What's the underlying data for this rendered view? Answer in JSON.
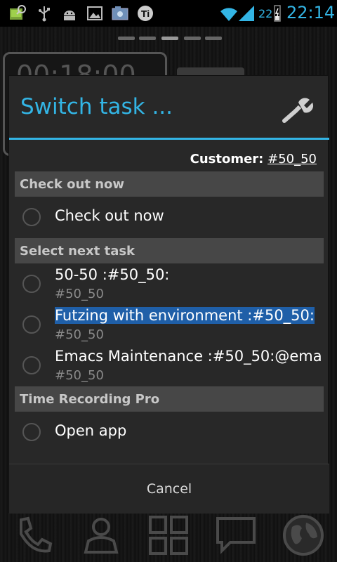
{
  "statusbar": {
    "battery_pct": "22",
    "time": "22:14",
    "icons": [
      "gallery-icon",
      "usb-icon",
      "android-debug-icon",
      "image-icon",
      "screenshot-icon",
      "titanium-icon",
      "wifi-icon",
      "signal-icon",
      "battery-icon"
    ]
  },
  "home": {
    "widget_time": "00:18:00"
  },
  "dialog": {
    "title": "Switch task ...",
    "customer_label": "Customer:",
    "customer_value": "#50_50",
    "sections": [
      {
        "label": "Check out now",
        "rows": [
          {
            "title": "Check out now"
          }
        ]
      },
      {
        "label": "Select next task",
        "rows": [
          {
            "title": "50-50 :#50_50:",
            "subtitle": "#50_50"
          },
          {
            "title": "Futzing with environment :#50_50:",
            "subtitle": "#50_50",
            "selected": true
          },
          {
            "title": "Emacs Maintenance :#50_50:@ema",
            "subtitle": "#50_50"
          }
        ]
      },
      {
        "label": "Time Recording Pro",
        "rows": [
          {
            "title": "Open app"
          }
        ]
      }
    ],
    "cancel_label": "Cancel"
  },
  "colors": {
    "accent": "#33b5e5",
    "selection": "#1f5fa8",
    "section_bg": "#474747",
    "dialog_bg": "#282828"
  }
}
